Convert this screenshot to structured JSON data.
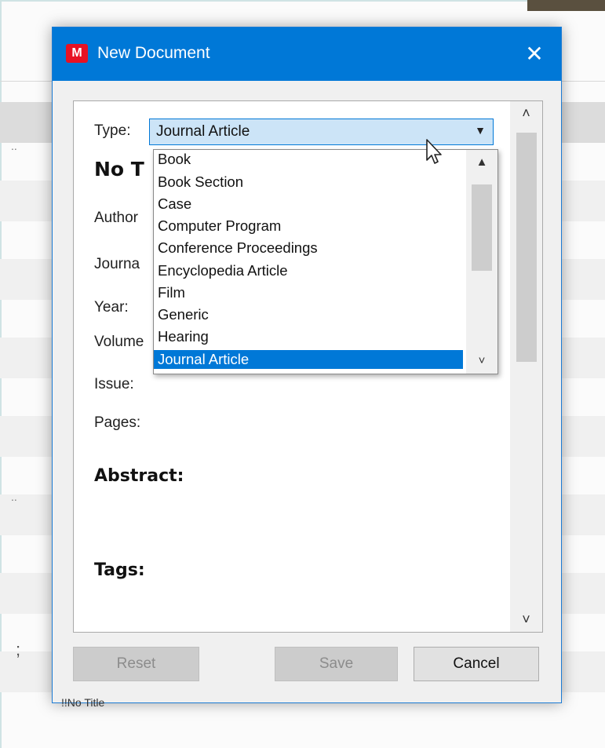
{
  "dialog": {
    "title": "New Document",
    "logo_glyph": "M",
    "close_label": "✕",
    "close_icon": "close-icon",
    "logo_icon": "mendeley-logo-icon"
  },
  "form": {
    "type_label": "Type:",
    "type_value": "Journal Article",
    "title_heading": "No T",
    "author_label": "Author",
    "journal_label": "Journa",
    "year_label": "Year:",
    "volume_label": "Volume",
    "issue_label": "Issue:",
    "pages_label": "Pages:",
    "abstract_heading": "Abstract:",
    "tags_heading": "Tags:"
  },
  "dropdown": {
    "options": [
      "Book",
      "Book Section",
      "Case",
      "Computer Program",
      "Conference Proceedings",
      "Encyclopedia Article",
      "Film",
      "Generic",
      "Hearing",
      "Journal Article"
    ],
    "selected": "Journal Article"
  },
  "buttons": {
    "reset": "Reset",
    "save": "Save",
    "cancel": "Cancel"
  },
  "background": {
    "partial_title": "!!No Title",
    "ellipsis_1": "..",
    "ellipsis_2": "..",
    "semicolon": ";"
  },
  "colors": {
    "titlebar": "#0078d7",
    "selection": "#0078d7",
    "logo": "#e81123"
  }
}
